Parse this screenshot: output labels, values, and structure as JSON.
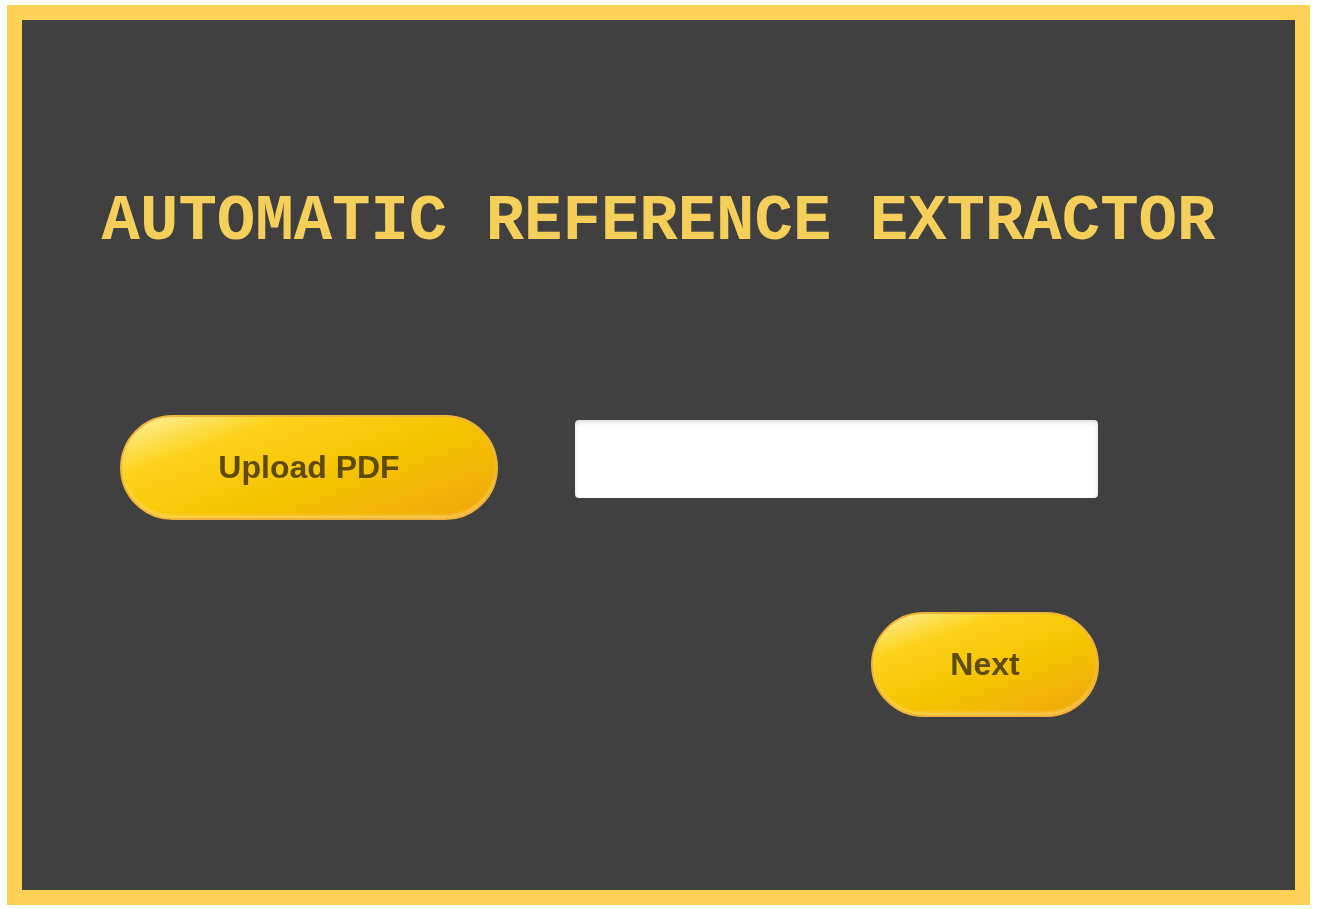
{
  "title": "AUTOMATIC REFERENCE EXTRACTOR",
  "upload_button": {
    "label": "Upload PDF"
  },
  "next_button": {
    "label": "Next"
  }
}
